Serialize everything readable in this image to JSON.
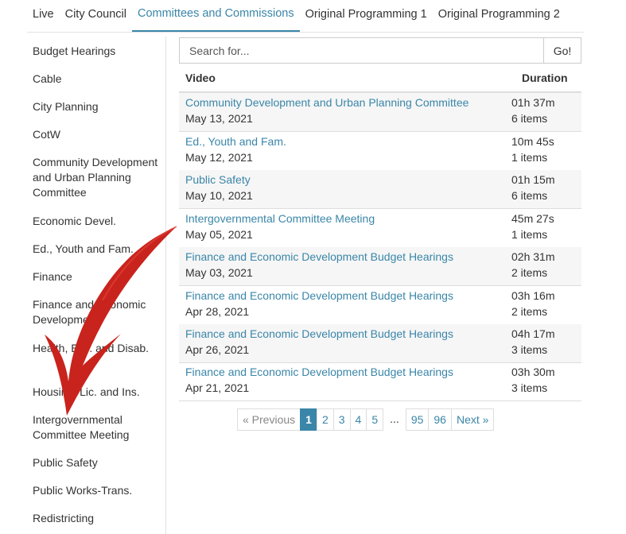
{
  "tabs": [
    {
      "label": "Live"
    },
    {
      "label": "City Council"
    },
    {
      "label": "Committees and Commissions",
      "active": true
    },
    {
      "label": "Original Programming 1"
    },
    {
      "label": "Original Programming 2"
    }
  ],
  "sidebar": {
    "items": [
      {
        "label": "Budget Hearings"
      },
      {
        "label": "Cable"
      },
      {
        "label": "City Planning"
      },
      {
        "label": "CotW"
      },
      {
        "label": "Community Development and Urban Planning Committee"
      },
      {
        "label": "Economic Devel."
      },
      {
        "label": "Ed., Youth and Fam."
      },
      {
        "label": "Finance"
      },
      {
        "label": "Finance and Economic Development"
      },
      {
        "label": "Health, Env. and Disab."
      },
      {
        "label": "Housing, Lic. and Ins."
      },
      {
        "label": "Intergovernmental Committee Meeting"
      },
      {
        "label": "Public Safety"
      },
      {
        "label": "Public Works-Trans."
      },
      {
        "label": "Redistricting"
      }
    ]
  },
  "search": {
    "placeholder": "Search for...",
    "button_label": "Go!"
  },
  "table": {
    "headers": {
      "video": "Video",
      "duration": "Duration"
    },
    "rows": [
      {
        "title": "Community Development and Urban Planning Committee",
        "date": "May 13, 2021",
        "duration": "01h 37m",
        "items": "6 items"
      },
      {
        "title": "Ed., Youth and Fam.",
        "date": "May 12, 2021",
        "duration": "10m 45s",
        "items": "1 items"
      },
      {
        "title": "Public Safety",
        "date": "May 10, 2021",
        "duration": "01h 15m",
        "items": "6 items"
      },
      {
        "title": "Intergovernmental Committee Meeting",
        "date": "May 05, 2021",
        "duration": "45m 27s",
        "items": "1 items"
      },
      {
        "title": "Finance and Economic Development Budget Hearings",
        "date": "May 03, 2021",
        "duration": "02h 31m",
        "items": "2 items"
      },
      {
        "title": "Finance and Economic Development Budget Hearings",
        "date": "Apr 28, 2021",
        "duration": "03h 16m",
        "items": "2 items"
      },
      {
        "title": "Finance and Economic Development Budget Hearings",
        "date": "Apr 26, 2021",
        "duration": "04h 17m",
        "items": "3 items"
      },
      {
        "title": "Finance and Economic Development Budget Hearings",
        "date": "Apr 21, 2021",
        "duration": "03h 30m",
        "items": "3 items"
      }
    ]
  },
  "pagination": {
    "previous": "« Previous",
    "pages": [
      "1",
      "2",
      "3",
      "4",
      "5"
    ],
    "ellipsis": "...",
    "last_pages": [
      "95",
      "96"
    ],
    "next": "Next »",
    "current": "1"
  },
  "colors": {
    "accent": "#3a86a8",
    "annotation_arrow": "#c9231d"
  }
}
